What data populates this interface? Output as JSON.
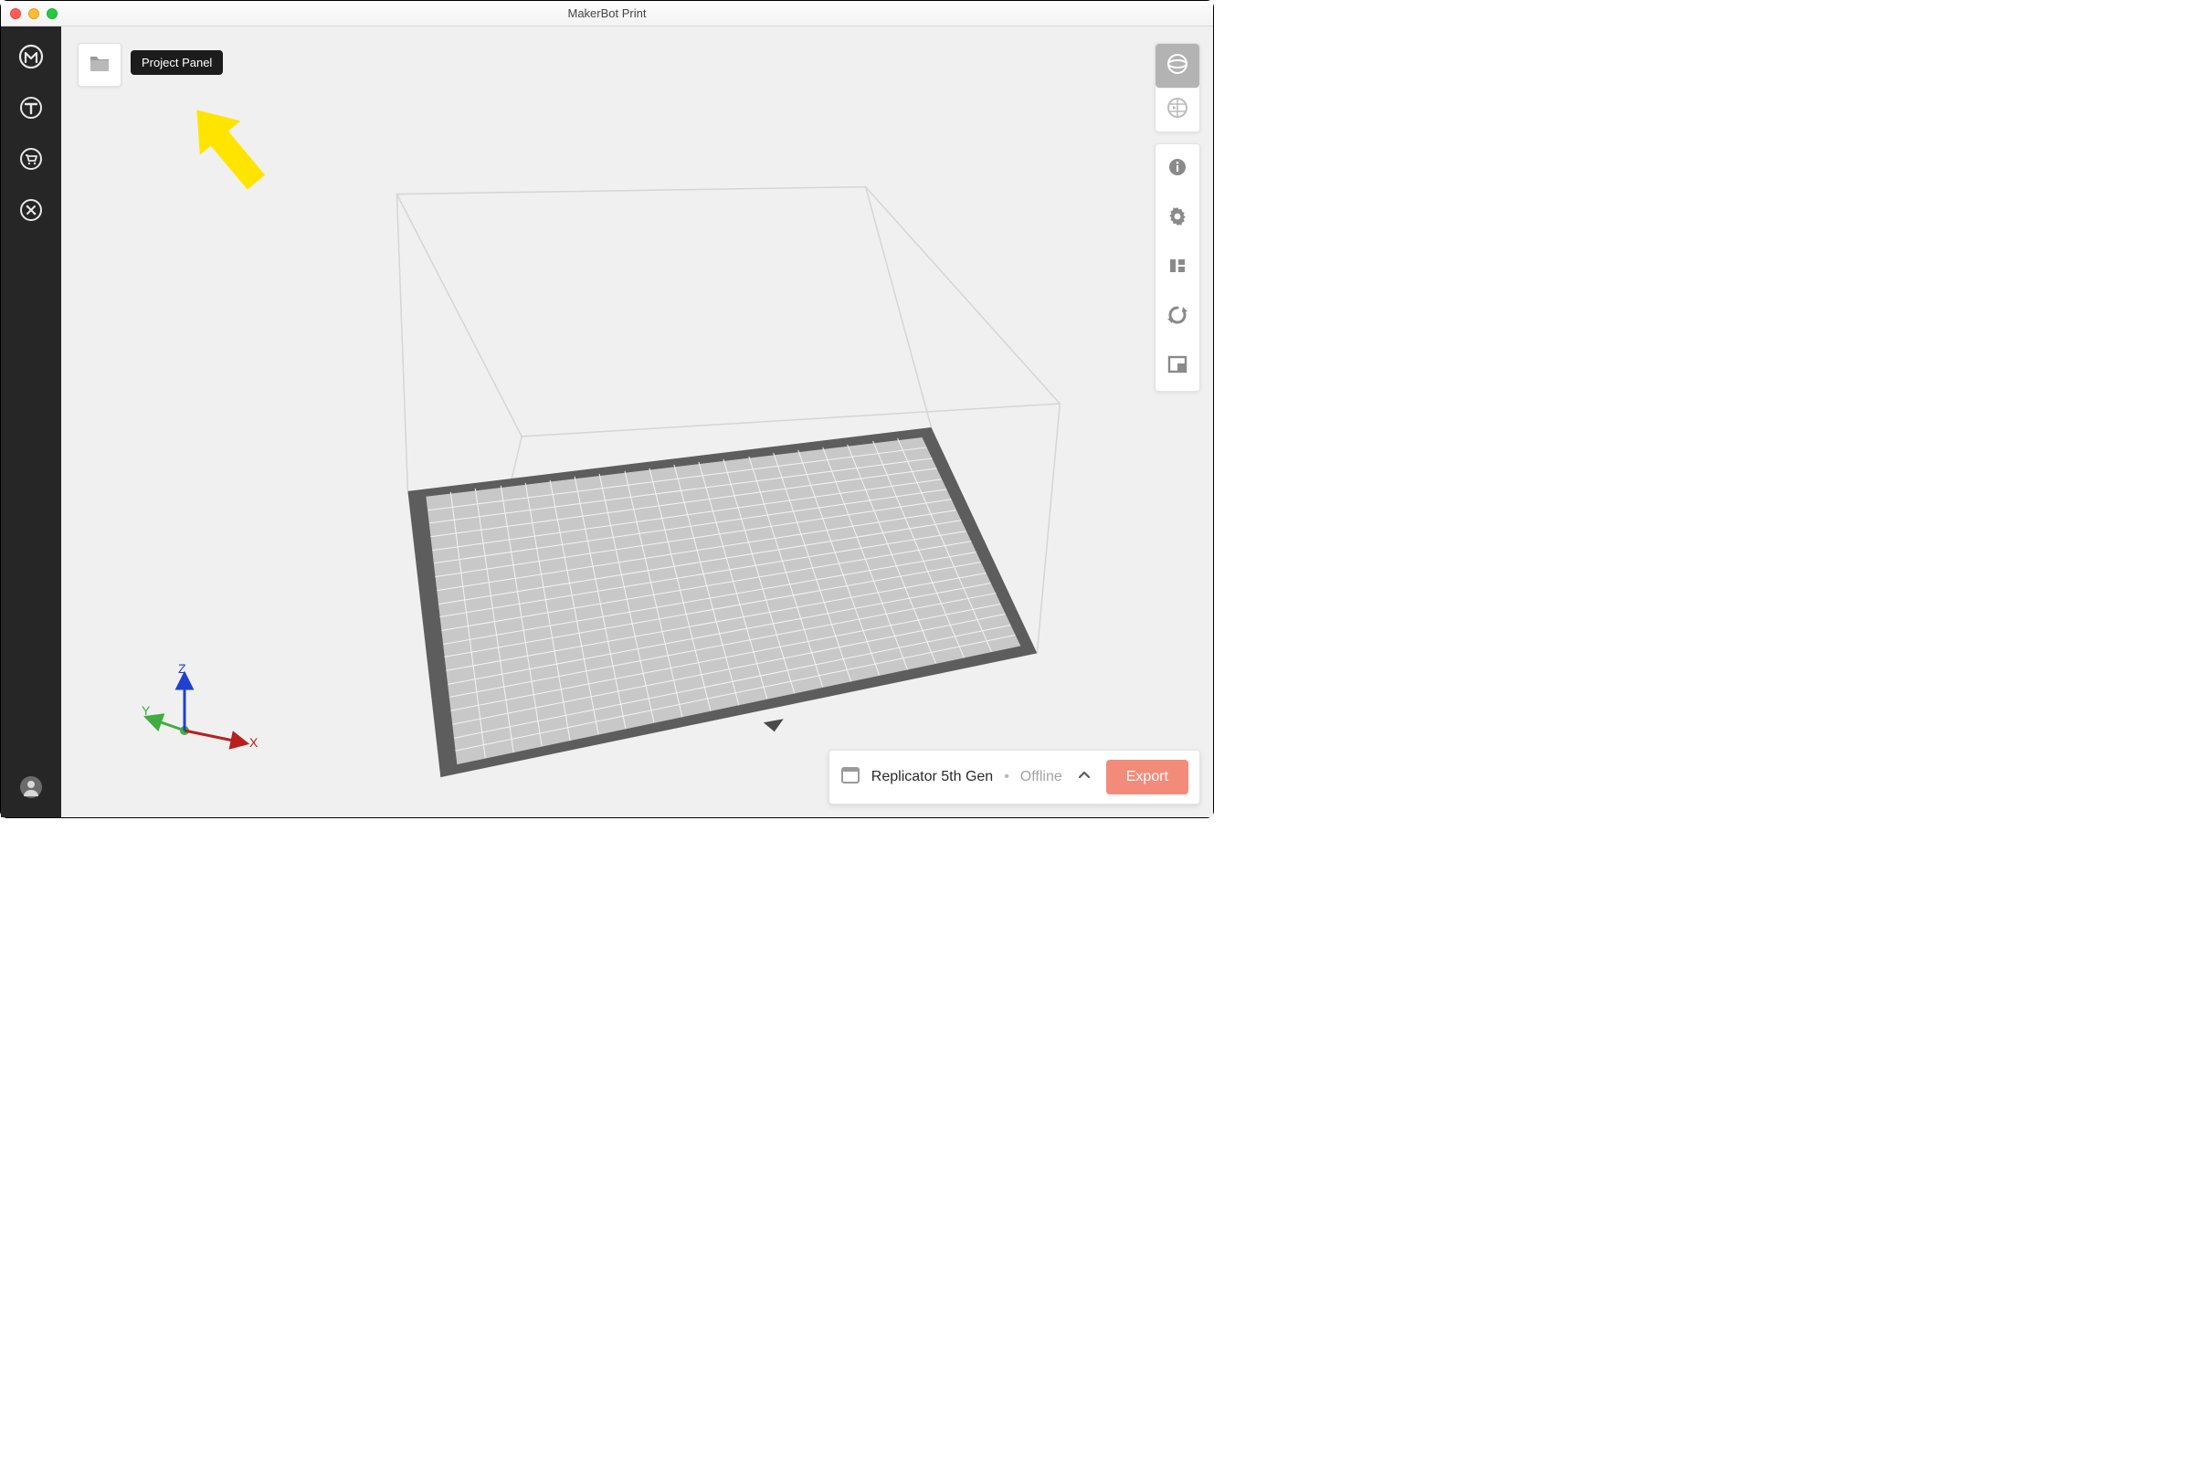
{
  "window": {
    "title": "MakerBot Print"
  },
  "tooltip": {
    "project_panel": "Project Panel"
  },
  "axes": {
    "x": "X",
    "y": "Y",
    "z": "Z"
  },
  "status": {
    "printer_name": "Replicator 5th Gen",
    "printer_status": "Offline",
    "export_label": "Export"
  },
  "sidebar_icons": [
    "makerbot-logo",
    "thingiverse",
    "store",
    "tools"
  ],
  "right_view_icons": [
    "view-solid",
    "view-layer"
  ],
  "right_tool_icons": [
    "info",
    "settings",
    "arrange",
    "refresh",
    "place-face"
  ]
}
